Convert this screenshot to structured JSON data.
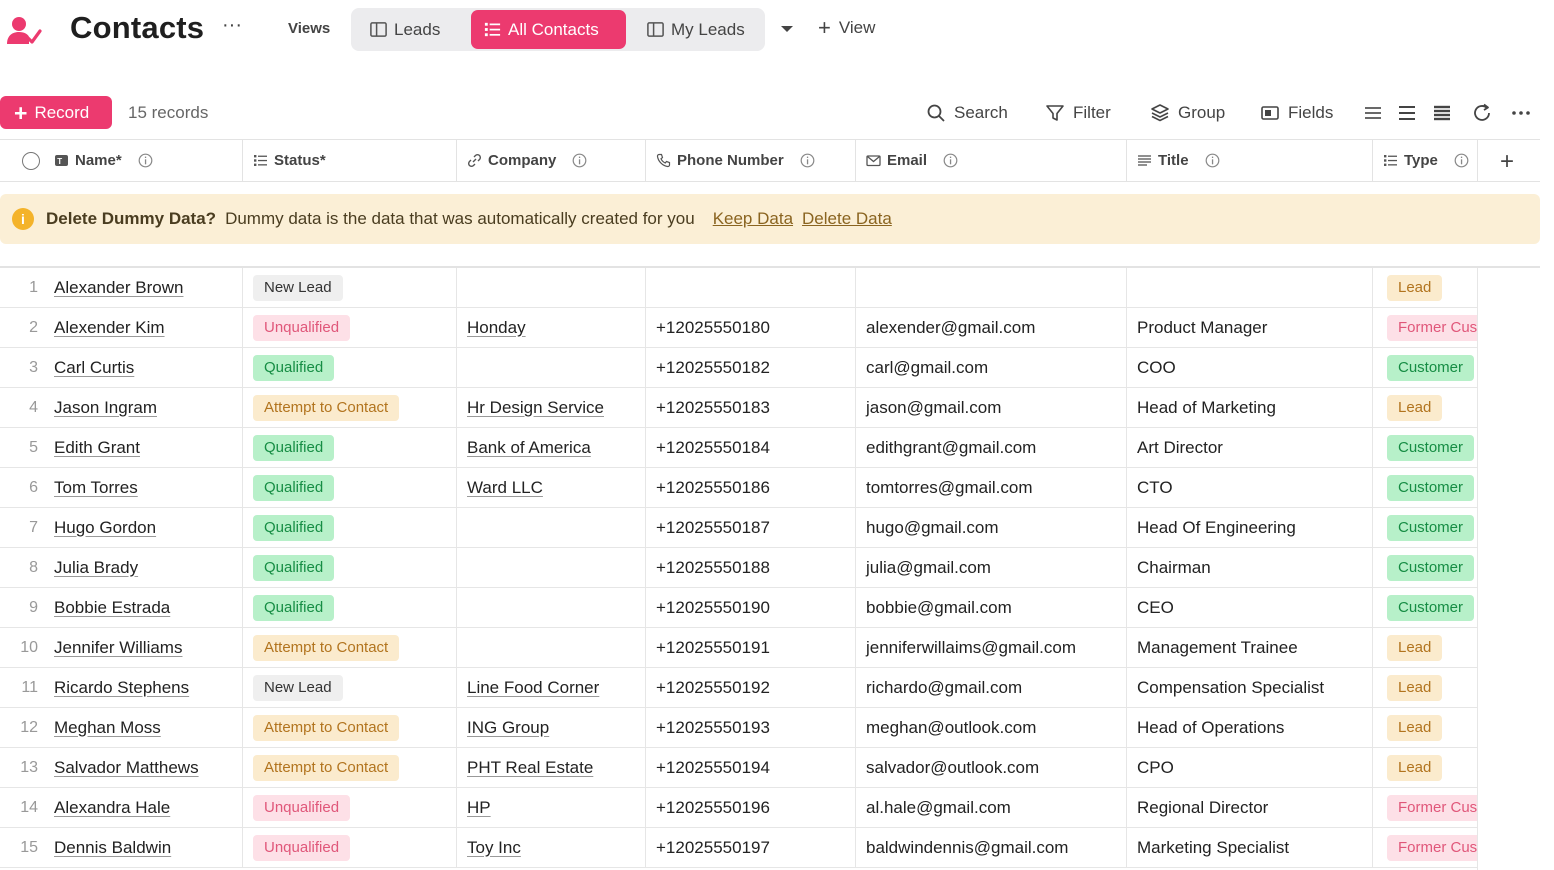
{
  "app": {
    "title": "Contacts",
    "more": "···",
    "views_label": "Views",
    "tabs": [
      {
        "label": "Leads",
        "icon": "board-icon",
        "active": false
      },
      {
        "label": "All Contacts",
        "icon": "list-icon",
        "active": true
      },
      {
        "label": "My Leads",
        "icon": "board-icon",
        "active": false
      }
    ],
    "add_view_label": "View",
    "accent_color": "#ec3a6f"
  },
  "toolbar": {
    "record_label": "Record",
    "record_count": "15 records",
    "search_label": "Search",
    "filter_label": "Filter",
    "group_label": "Group",
    "fields_label": "Fields"
  },
  "columns": [
    {
      "label": "Name*",
      "icon": "text-field-icon"
    },
    {
      "label": "Status*",
      "icon": "list-field-icon"
    },
    {
      "label": "Company",
      "icon": "link-icon"
    },
    {
      "label": "Phone Number",
      "icon": "phone-icon"
    },
    {
      "label": "Email",
      "icon": "mail-icon"
    },
    {
      "label": "Title",
      "icon": "lines-icon"
    },
    {
      "label": "Type",
      "icon": "list-field-icon"
    }
  ],
  "banner": {
    "title": "Delete Dummy Data?",
    "text": "Dummy data is the data that was automatically created for you",
    "keep_label": "Keep Data",
    "delete_label": "Delete Data"
  },
  "rows": [
    {
      "n": "1",
      "name": "Alexander Brown",
      "status": "New Lead",
      "status_kind": "newlead",
      "company": "",
      "phone": "",
      "email": "",
      "title": "",
      "type": "Lead",
      "type_kind": "lead"
    },
    {
      "n": "2",
      "name": "Alexender Kim",
      "status": "Unqualified",
      "status_kind": "unqualified",
      "company": "Honday",
      "phone": "+12025550180",
      "email": "alexender@gmail.com",
      "title": "Product Manager",
      "type": "Former Customer",
      "type_kind": "former"
    },
    {
      "n": "3",
      "name": "Carl Curtis",
      "status": "Qualified",
      "status_kind": "qualified",
      "company": "",
      "phone": "+12025550182",
      "email": "carl@gmail.com",
      "title": "COO",
      "type": "Customer",
      "type_kind": "customer"
    },
    {
      "n": "4",
      "name": "Jason Ingram",
      "status": "Attempt to Contact",
      "status_kind": "attempt",
      "company": "Hr Design Service",
      "phone": "+12025550183",
      "email": "jason@gmail.com",
      "title": "Head of Marketing",
      "type": "Lead",
      "type_kind": "lead"
    },
    {
      "n": "5",
      "name": "Edith Grant",
      "status": "Qualified",
      "status_kind": "qualified",
      "company": "Bank of America",
      "phone": "+12025550184",
      "email": "edithgrant@gmail.com",
      "title": "Art Director",
      "type": "Customer",
      "type_kind": "customer"
    },
    {
      "n": "6",
      "name": "Tom Torres",
      "status": "Qualified",
      "status_kind": "qualified",
      "company": "Ward LLC",
      "phone": "+12025550186",
      "email": "tomtorres@gmail.com",
      "title": "CTO",
      "type": "Customer",
      "type_kind": "customer"
    },
    {
      "n": "7",
      "name": "Hugo Gordon",
      "status": "Qualified",
      "status_kind": "qualified",
      "company": "",
      "phone": "+12025550187",
      "email": "hugo@gmail.com",
      "title": "Head Of Engineering",
      "type": "Customer",
      "type_kind": "customer"
    },
    {
      "n": "8",
      "name": "Julia Brady",
      "status": "Qualified",
      "status_kind": "qualified",
      "company": "",
      "phone": "+12025550188",
      "email": "julia@gmail.com",
      "title": "Chairman",
      "type": "Customer",
      "type_kind": "customer"
    },
    {
      "n": "9",
      "name": "Bobbie Estrada",
      "status": "Qualified",
      "status_kind": "qualified",
      "company": "",
      "phone": "+12025550190",
      "email": "bobbie@gmail.com",
      "title": "CEO",
      "type": "Customer",
      "type_kind": "customer"
    },
    {
      "n": "10",
      "name": "Jennifer Williams",
      "status": "Attempt to Contact",
      "status_kind": "attempt",
      "company": "",
      "phone": "+12025550191",
      "email": "jenniferwillaims@gmail.com",
      "title": "Management Trainee",
      "type": "Lead",
      "type_kind": "lead"
    },
    {
      "n": "11",
      "name": "Ricardo Stephens",
      "status": "New Lead",
      "status_kind": "newlead",
      "company": "Line Food Corner",
      "phone": "+12025550192",
      "email": "richardo@gmail.com",
      "title": "Compensation Specialist",
      "type": "Lead",
      "type_kind": "lead"
    },
    {
      "n": "12",
      "name": "Meghan Moss",
      "status": "Attempt to Contact",
      "status_kind": "attempt",
      "company": "ING Group",
      "phone": "+12025550193",
      "email": "meghan@outlook.com",
      "title": "Head of Operations",
      "type": "Lead",
      "type_kind": "lead"
    },
    {
      "n": "13",
      "name": "Salvador Matthews",
      "status": "Attempt to Contact",
      "status_kind": "attempt",
      "company": "PHT Real Estate",
      "phone": "+12025550194",
      "email": "salvador@outlook.com",
      "title": "CPO",
      "type": "Lead",
      "type_kind": "lead"
    },
    {
      "n": "14",
      "name": "Alexandra Hale",
      "status": "Unqualified",
      "status_kind": "unqualified",
      "company": "HP",
      "phone": "+12025550196",
      "email": "al.hale@gmail.com",
      "title": "Regional Director",
      "type": "Former Customer",
      "type_kind": "former"
    },
    {
      "n": "15",
      "name": "Dennis Baldwin",
      "status": "Unqualified",
      "status_kind": "unqualified",
      "company": "Toy Inc",
      "phone": "+12025550197",
      "email": "baldwindennis@gmail.com",
      "title": "Marketing Specialist",
      "type": "Former Customer",
      "type_kind": "former"
    }
  ]
}
